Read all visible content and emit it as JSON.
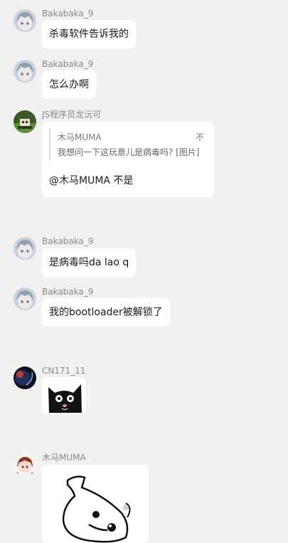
{
  "messages": [
    {
      "sender": "Bakabaka_9",
      "avatar": "anime-girl-blue-hair-avatar",
      "text": "杀毒软件告诉我的"
    },
    {
      "sender": "Bakabaka_9",
      "avatar": "anime-girl-blue-hair-avatar",
      "text": "怎么办啊"
    },
    {
      "sender": "JS程序员龙沅可",
      "avatar": "pixel-landscape-avatar",
      "reply": {
        "name": "木马MUMA",
        "time": "不",
        "text": "我想问一下这玩意儿是病毒吗? [图片]"
      },
      "text": "@木马MUMA 不是"
    },
    {
      "sender": "Bakabaka_9",
      "avatar": "anime-girl-blue-hair-avatar",
      "text": "是病毒吗da lao q"
    },
    {
      "sender": "Bakabaka_9",
      "avatar": "anime-girl-blue-hair-avatar",
      "text": "我的bootloader被解锁了"
    },
    {
      "sender": "CN171_11",
      "avatar": "dark-planet-avatar",
      "image": "black-cat-sticker"
    },
    {
      "sender": "木马MUMA",
      "avatar": "anime-girl-red-hair-avatar",
      "image": "white-blob-sticker"
    }
  ],
  "colors": {
    "background": "#f1f1f1",
    "bubble": "#ffffff",
    "name": "#8a8a8a"
  }
}
